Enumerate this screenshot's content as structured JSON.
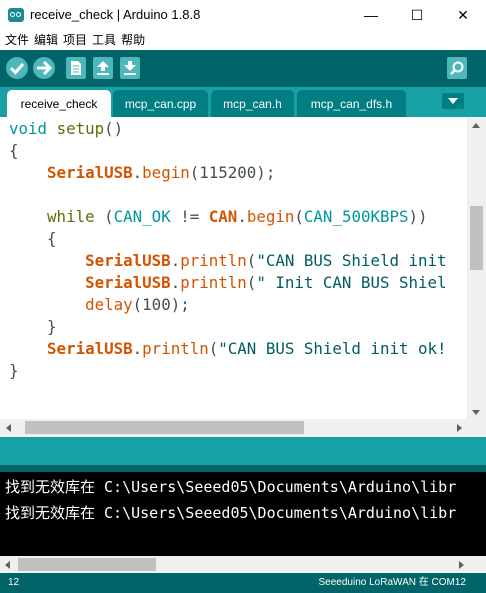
{
  "window": {
    "title": "receive_check | Arduino 1.8.8",
    "minimize_glyph": "—",
    "maximize_glyph": "☐",
    "close_glyph": "✕"
  },
  "menu": [
    "文件",
    "编辑",
    "项目",
    "工具",
    "帮助"
  ],
  "toolbar": {
    "buttons": [
      "verify-icon",
      "upload-icon",
      "new-icon",
      "open-icon",
      "save-icon",
      "serial-monitor-icon"
    ]
  },
  "tabs": [
    {
      "label": "receive_check",
      "active": true
    },
    {
      "label": "mcp_can.cpp",
      "active": false
    },
    {
      "label": "mcp_can.h",
      "active": false
    },
    {
      "label": "mcp_can_dfs.h",
      "active": false
    }
  ],
  "code": {
    "l1_void": "void",
    "l1_setup": "setup",
    "l1_rest": "()",
    "l2": "{",
    "l3_obj": "SerialUSB",
    "l3_dot": ".",
    "l3_fn": "begin",
    "l3_rest": "(115200);",
    "l5_while": "while",
    "l5_p1": " (",
    "l5_const": "CAN_OK",
    "l5_op": " != ",
    "l5_can": "CAN",
    "l5_dot": ".",
    "l5_fn": "begin",
    "l5_p2": "(",
    "l5_speed": "CAN_500KBPS",
    "l5_p3": "))",
    "l6": "{",
    "l7_obj": "SerialUSB",
    "l7_dot": ".",
    "l7_fn": "println",
    "l7_p": "(",
    "l7_str": "\"CAN BUS Shield init",
    "l8_obj": "SerialUSB",
    "l8_dot": ".",
    "l8_fn": "println",
    "l8_p": "(",
    "l8_str": "\" Init CAN BUS Shiel",
    "l9_fn": "delay",
    "l9_rest": "(100);",
    "l10": "}",
    "l11_obj": "SerialUSB",
    "l11_dot": ".",
    "l11_fn": "println",
    "l11_p": "(",
    "l11_str": "\"CAN BUS Shield init ok!",
    "l12": "}"
  },
  "console": {
    "lines": [
      "找到无效库在 C:\\Users\\Seeed05\\Documents\\Arduino\\libr",
      "找到无效库在 C:\\Users\\Seeed05\\Documents\\Arduino\\libr"
    ]
  },
  "status": {
    "line": "12",
    "board": "Seeeduino LoRaWAN 在 COM12"
  },
  "colors": {
    "toolbar": "#006468",
    "tabbar": "#17a1a5",
    "button": "#4db7bb",
    "serial_keyword": "#d35400",
    "constant": "#00979c",
    "string": "#005c5f"
  }
}
